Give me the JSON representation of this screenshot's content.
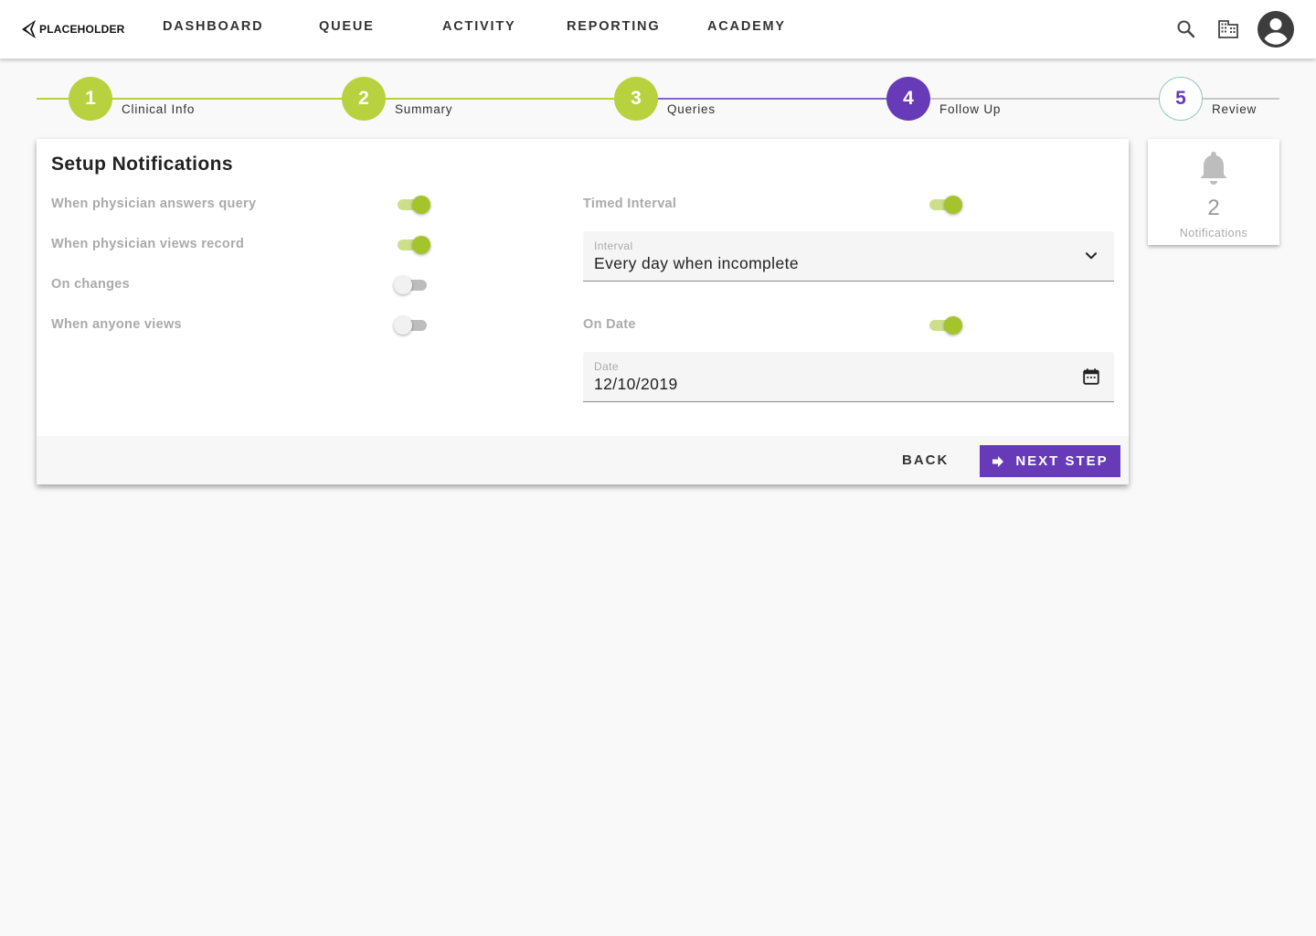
{
  "logo": {
    "text": "PLACEHOLDER"
  },
  "nav": [
    {
      "label": "DASHBOARD"
    },
    {
      "label": "QUEUE"
    },
    {
      "label": "ACTIVITY"
    },
    {
      "label": "REPORTING"
    },
    {
      "label": "ACADEMY"
    }
  ],
  "header_icons": [
    "search-icon",
    "building-icon",
    "account-circle-icon"
  ],
  "stepper": {
    "steps": [
      {
        "number": "1",
        "label": "Clinical Info",
        "state": "complete"
      },
      {
        "number": "2",
        "label": "Summary",
        "state": "complete"
      },
      {
        "number": "3",
        "label": "Queries",
        "state": "complete"
      },
      {
        "number": "4",
        "label": "Follow Up",
        "state": "active"
      },
      {
        "number": "5",
        "label": "Review",
        "state": "upcoming"
      }
    ]
  },
  "notifications_setup": {
    "title": "Setup Notifications",
    "left_options": [
      {
        "label": "When physician answers query",
        "enabled": true
      },
      {
        "label": "When physician views record",
        "enabled": true
      },
      {
        "label": "On changes",
        "enabled": false
      },
      {
        "label": "When anyone views",
        "enabled": false
      }
    ],
    "timed_interval": {
      "label": "Timed Interval",
      "enabled": true
    },
    "interval_field": {
      "label": "Interval",
      "value": "Every day when incomplete"
    },
    "on_date": {
      "label": "On Date",
      "enabled": true
    },
    "date_field": {
      "label": "Date",
      "value": "12/10/2019"
    },
    "back_label": "BACK",
    "next_label": "NEXT STEP"
  },
  "notifications_panel": {
    "count": "2",
    "label": "Notifications"
  },
  "colors": {
    "accent_green": "#a5c42c",
    "accent_purple": "#673ab7",
    "upcoming_border": "#8fc9b4"
  }
}
